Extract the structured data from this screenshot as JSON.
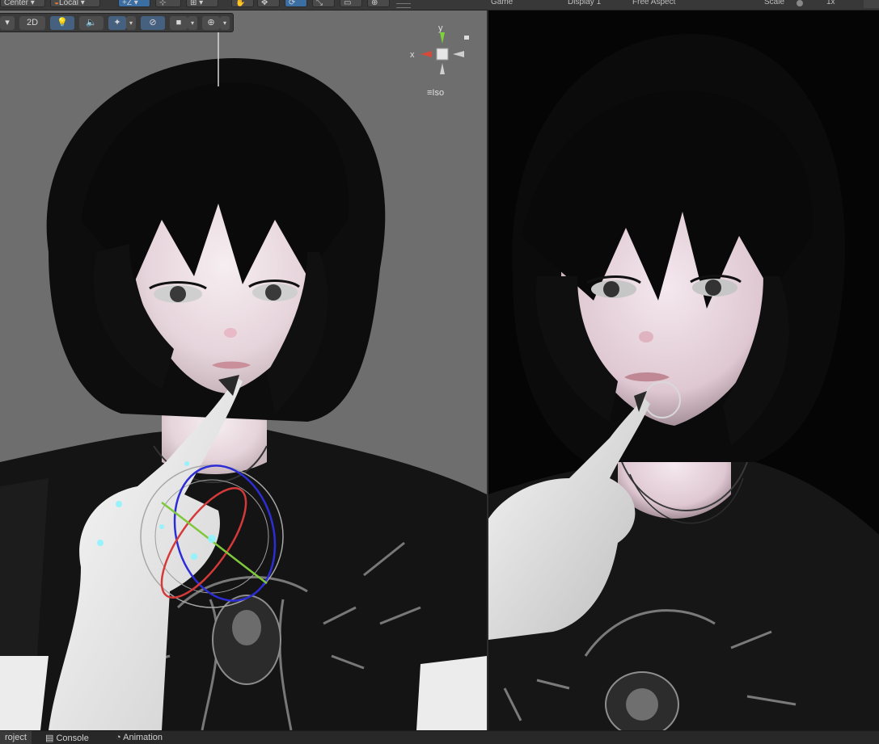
{
  "top_toolbar": {
    "pivot_label": "Center",
    "space_label": "Local",
    "increment_label": "+Z"
  },
  "scene_toolbar": {
    "mode_2d_label": "2D"
  },
  "orientation_gizmo": {
    "y_label": "y",
    "x_label": "x",
    "projection_label": "Iso"
  },
  "game_header": {
    "tab_label": "Game",
    "display_label": "Display 1",
    "aspect_label": "Free Aspect",
    "scale_label": "Scale",
    "scale_value": "1x"
  },
  "bottom_tabs": {
    "project_label": "roject",
    "console_label": "Console",
    "animation_label": "Animation"
  },
  "colors": {
    "accent_blue": "#3b6ea3",
    "gizmo_y": "#7ed33a",
    "gizmo_x": "#d64a3c"
  }
}
